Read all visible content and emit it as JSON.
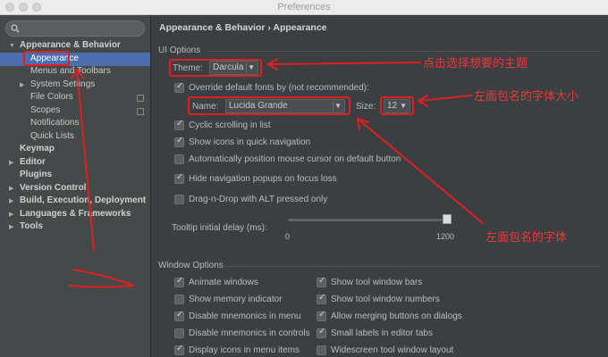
{
  "window": {
    "title": "Preferences"
  },
  "sidebar": {
    "items": [
      {
        "label": "Appearance & Behavior",
        "expanded": true
      },
      {
        "label": "Appearance"
      },
      {
        "label": "Menus and Toolbars"
      },
      {
        "label": "System Settings"
      },
      {
        "label": "File Colors"
      },
      {
        "label": "Scopes"
      },
      {
        "label": "Notifications"
      },
      {
        "label": "Quick Lists"
      },
      {
        "label": "Keymap"
      },
      {
        "label": "Editor"
      },
      {
        "label": "Plugins"
      },
      {
        "label": "Version Control"
      },
      {
        "label": "Build, Execution, Deployment"
      },
      {
        "label": "Languages & Frameworks"
      },
      {
        "label": "Tools"
      }
    ]
  },
  "breadcrumb": "Appearance & Behavior › Appearance",
  "ui_options": {
    "section_title": "UI Options",
    "theme_label": "Theme:",
    "theme_value": "Darcula",
    "override_fonts_label": "Override default fonts by (not recommended):",
    "name_label": "Name:",
    "name_value": "Lucida Grande",
    "size_label": "Size:",
    "size_value": "12",
    "cyclic_scrolling": "Cyclic scrolling in list",
    "show_icons_nav": "Show icons in quick navigation",
    "auto_position": "Automatically position mouse cursor on default button",
    "hide_nav_popups": "Hide navigation popups on focus loss",
    "drag_n_drop": "Drag-n-Drop with ALT pressed only",
    "tooltip_label": "Tooltip initial delay (ms):",
    "tooltip_min": "0",
    "tooltip_max": "1200",
    "tooltip_value_fraction": 1.0
  },
  "window_options": {
    "section_title": "Window Options",
    "left": [
      {
        "label": "Animate windows",
        "checked": true
      },
      {
        "label": "Show memory indicator",
        "checked": false
      },
      {
        "label": "Disable mnemonics in menu",
        "checked": true
      },
      {
        "label": "Disable mnemonics in controls",
        "checked": false
      },
      {
        "label": "Display icons in menu items",
        "checked": true
      }
    ],
    "right": [
      {
        "label": "Show tool window bars",
        "checked": true
      },
      {
        "label": "Show tool window numbers",
        "checked": true
      },
      {
        "label": "Allow merging buttons on dialogs",
        "checked": true
      },
      {
        "label": "Small labels in editor tabs",
        "checked": true
      },
      {
        "label": "Widescreen tool window layout",
        "checked": false
      }
    ]
  },
  "annotations": {
    "theme_note": "点击选择想要的主题",
    "size_note": "左面包名的字体大小",
    "font_note": "左面包名的字体",
    "accent_color": "#e02020"
  }
}
